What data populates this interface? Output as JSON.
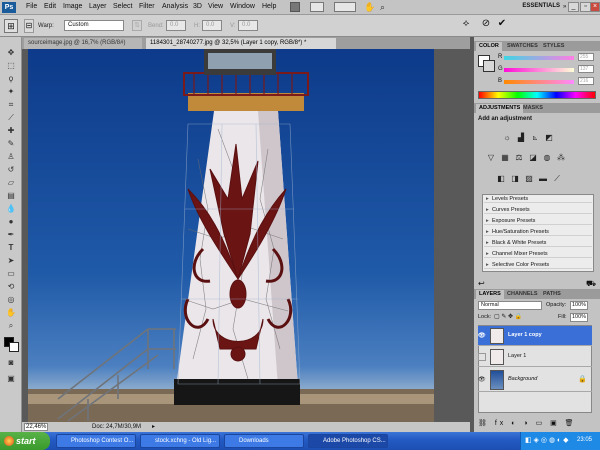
{
  "app": {
    "logo": "Ps"
  },
  "menubar": {
    "items": [
      "File",
      "Edit",
      "Image",
      "Layer",
      "Select",
      "Filter",
      "Analysis",
      "3D",
      "View",
      "Window",
      "Help"
    ],
    "workspace": "ESSENTIALS"
  },
  "options": {
    "warp_label": "Warp:",
    "warp_value": "Custom",
    "bend_label": "Bend:",
    "bend_value": "0.0",
    "h_label": "H:",
    "h_value": "0.0",
    "v_label": "V:",
    "v_value": "0.0"
  },
  "document": {
    "tabs": [
      {
        "label": "sourceimage.jpg @ 16,7% (RGB/8#)",
        "active": false
      },
      {
        "label": "1184301_28740277.jpg @ 32,5% (Layer 1 copy, RGB/8*) *",
        "active": true
      }
    ]
  },
  "status": {
    "zoom": "22,46%",
    "doc": "Doc: 24,7M/30,9M"
  },
  "color_panel": {
    "tabs": [
      "COLOR",
      "SWATCHES",
      "STYLES"
    ],
    "r_label": "R",
    "r_value": "255",
    "g_label": "G",
    "g_value": "137",
    "b_label": "B",
    "b_value": "216"
  },
  "adjustments": {
    "tabs": [
      "ADJUSTMENTS",
      "MASKS"
    ],
    "heading": "Add an adjustment",
    "presets": [
      "Levels Presets",
      "Curves Presets",
      "Exposure Presets",
      "Hue/Saturation Presets",
      "Black & White Presets",
      "Channel Mixer Presets",
      "Selective Color Presets"
    ]
  },
  "layers_panel": {
    "tabs": [
      "LAYERS",
      "CHANNELS",
      "PATHS"
    ],
    "blend_mode": "Normal",
    "opacity_label": "Opacity:",
    "opacity_value": "100%",
    "lock_label": "Lock:",
    "fill_label": "Fill:",
    "fill_value": "100%",
    "layers": [
      {
        "name": "Layer 1 copy",
        "selected": true,
        "visible": true
      },
      {
        "name": "Layer 1",
        "selected": false,
        "visible": false
      },
      {
        "name": "Background",
        "selected": false,
        "visible": true,
        "locked": true
      }
    ]
  },
  "taskbar": {
    "start": "start",
    "tasks": [
      "Photoshop Contest O...",
      "stock.xchng - Old Lig...",
      "Downloads",
      "Adobe Photoshop CS..."
    ],
    "clock": "23:05"
  },
  "colors": {
    "selection": "#3a6fd8",
    "taskbar": "#245bc4",
    "pattern": "#6b1414"
  }
}
